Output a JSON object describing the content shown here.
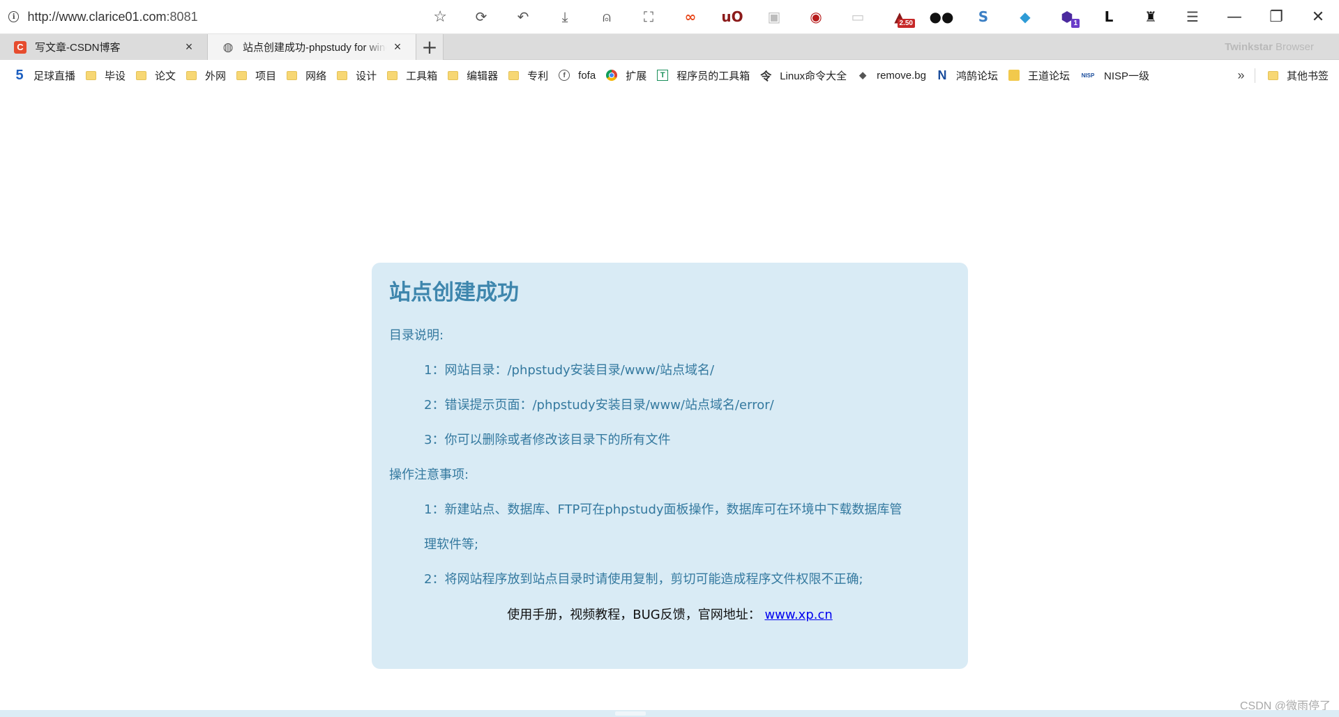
{
  "address_bar": {
    "url_host": "http://www.clarice01.com",
    "url_port": ":8081"
  },
  "toolbar_icons": [
    {
      "name": "reload-icon",
      "glyph": "⟳"
    },
    {
      "name": "undo-icon",
      "glyph": "↶"
    },
    {
      "name": "download-icon",
      "glyph": "⤓"
    },
    {
      "name": "account-icon",
      "glyph": "⍝"
    },
    {
      "name": "crop-icon",
      "glyph": "⛶"
    },
    {
      "name": "infinity-extension-icon",
      "glyph": "∞",
      "color": "#e8491d"
    },
    {
      "name": "ublock-icon",
      "glyph": "uO",
      "color": "#8b1a1a"
    },
    {
      "name": "image-extension-icon",
      "glyph": "▣",
      "color": "#bdbdbd"
    },
    {
      "name": "record-extension-icon",
      "glyph": "◉",
      "color": "#b71c1c"
    },
    {
      "name": "screen-extension-icon",
      "glyph": "▭",
      "color": "#c8c8c8"
    },
    {
      "name": "speed-extension-icon",
      "glyph": "▲",
      "color": "#8b1a1a",
      "badge": "2.50"
    },
    {
      "name": "tampermonkey-icon",
      "glyph": "●●",
      "color": "#111111"
    },
    {
      "name": "s-extension-icon",
      "glyph": "S",
      "color": "#3b7fc4"
    },
    {
      "name": "shield-extension-icon",
      "glyph": "◆",
      "color": "#2e9bd6"
    },
    {
      "name": "cube-extension-icon",
      "glyph": "⬢",
      "color": "#4b2a9e",
      "badge": "1"
    },
    {
      "name": "l-extension-icon",
      "glyph": "L",
      "color": "#111111"
    },
    {
      "name": "hat-extension-icon",
      "glyph": "♜",
      "color": "#111111"
    },
    {
      "name": "menu-icon",
      "glyph": "☰",
      "color": "#444444"
    }
  ],
  "window_controls": {
    "minimize": "—",
    "restore": "❐",
    "close": "✕"
  },
  "tabs": [
    {
      "title": "写文章-CSDN博客",
      "favicon": "C",
      "active": false
    },
    {
      "title": "站点创建成功-phpstudy for windows",
      "favicon": "globe",
      "active": true
    }
  ],
  "tabstrip": {
    "new_tab": "+",
    "brand_bold": "Twinkstar",
    "brand_rest": "Browser"
  },
  "bookmarks": [
    {
      "label": "足球直播",
      "icon": "five"
    },
    {
      "label": "毕设",
      "icon": "folder"
    },
    {
      "label": "论文",
      "icon": "folder"
    },
    {
      "label": "外网",
      "icon": "folder"
    },
    {
      "label": "项目",
      "icon": "folder"
    },
    {
      "label": "网络",
      "icon": "folder"
    },
    {
      "label": "设计",
      "icon": "folder"
    },
    {
      "label": "工具箱",
      "icon": "folder"
    },
    {
      "label": "编辑器",
      "icon": "folder"
    },
    {
      "label": "专利",
      "icon": "folder"
    },
    {
      "label": "fofa",
      "icon": "fofa"
    },
    {
      "label": "扩展",
      "icon": "chrome"
    },
    {
      "label": "程序员的工具箱",
      "icon": "tool"
    },
    {
      "label": "Linux命令大全",
      "icon": "linux"
    },
    {
      "label": "remove.bg",
      "icon": "removebg"
    },
    {
      "label": "鸿鹄论坛",
      "icon": "hongke"
    },
    {
      "label": "王道论坛",
      "icon": "wangdao"
    },
    {
      "label": "NISP一级",
      "icon": "nisp"
    }
  ],
  "bookmarks_more": {
    "chevron": "»",
    "other_label": "其他书签"
  },
  "page": {
    "heading": "站点创建成功",
    "dir_title": "目录说明:",
    "dir_items": [
      "1：网站目录：/phpstudy安装目录/www/站点域名/",
      "2：错误提示页面：/phpstudy安装目录/www/站点域名/error/",
      "3：你可以删除或者修改该目录下的所有文件"
    ],
    "ops_title": "操作注意事项:",
    "ops_items": [
      "1：新建站点、数据库、FTP可在phpstudy面板操作，数据库可在环境中下载数据库管",
      "理软件等;",
      "2：将网站程序放到站点目录时请使用复制，剪切可能造成程序文件权限不正确;"
    ],
    "footer_text": "使用手册，视频教程，BUG反馈，官网地址：",
    "footer_link": "www.xp.cn"
  },
  "watermark": "CSDN @微雨停了"
}
